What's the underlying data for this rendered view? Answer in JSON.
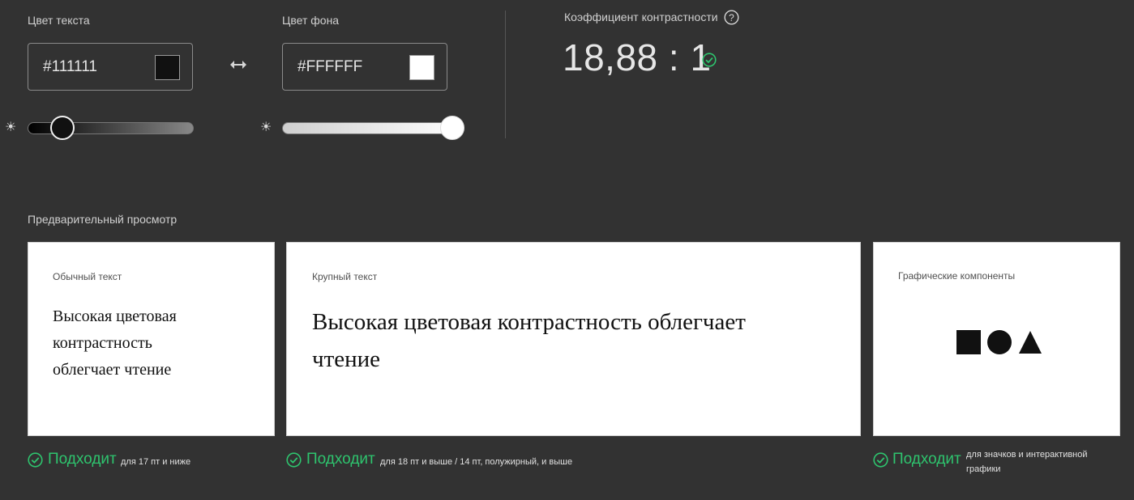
{
  "text_color": {
    "label": "Цвет текста",
    "hex": "#111111",
    "swatch": "#111111",
    "brightness_level": 0.2
  },
  "background_color": {
    "label": "Цвет фона",
    "hex": "#FFFFFF",
    "swatch": "#FFFFFF",
    "brightness_level": 1.0
  },
  "contrast": {
    "label": "Коэффициент контрастности",
    "value": "18,88 : 1"
  },
  "preview": {
    "label": "Предварительный просмотр",
    "cards": {
      "normal": {
        "title": "Обычный текст",
        "sample": "Высокая цветовая контрастность облегчает чтение"
      },
      "large": {
        "title": "Крупный текст",
        "sample": "Высокая цветовая контрастность облегчает чтение"
      },
      "graphics": {
        "title": "Графические компоненты"
      }
    }
  },
  "results": {
    "normal": {
      "status": "Подходит",
      "note": "для 17 пт и ниже"
    },
    "large": {
      "status": "Подходит",
      "note": "для 18 пт и выше / 14 пт, полужирный, и выше"
    },
    "graphics": {
      "status": "Подходит",
      "note": "для значков и интерактивной графики"
    }
  },
  "colors": {
    "background": "#323232",
    "pass_green": "#2ec46e"
  },
  "icons": [
    "swap-arrows-icon",
    "brightness-icon",
    "help-icon",
    "check-circle-icon",
    "square-icon",
    "circle-icon",
    "triangle-icon"
  ]
}
